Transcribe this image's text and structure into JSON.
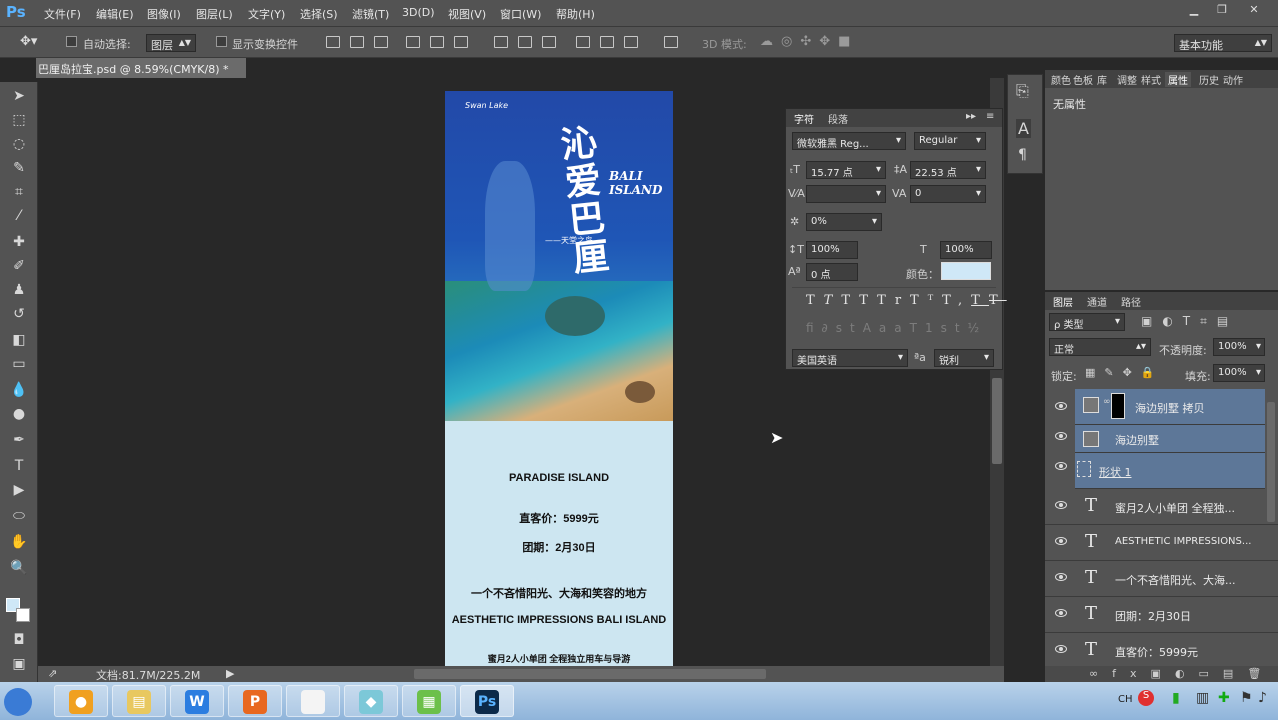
{
  "menubar": {
    "logo": "Ps",
    "items": [
      "文件(F)",
      "编辑(E)",
      "图像(I)",
      "图层(L)",
      "文字(Y)",
      "选择(S)",
      "滤镜(T)",
      "3D(D)",
      "视图(V)",
      "窗口(W)",
      "帮助(H)"
    ]
  },
  "options": {
    "auto_select_label": "自动选择:",
    "auto_select_value": "图层",
    "show_transform_label": "显示变换控件",
    "mode_3d_label": "3D 模式:",
    "workspace": "基本功能"
  },
  "document": {
    "tab_title": "巴厘岛拉宝.psd @ 8.59%(CMYK/8) *",
    "tab_close": "×",
    "status": "文档:81.7M/225.2M",
    "poster": {
      "brand": "Swan Lake",
      "title_cn": "沁爱巴厘",
      "title_en_1": "BALI",
      "title_en_2": "ISLAND",
      "subtitle": "——天堂之岛",
      "line1": "PARADISE ISLAND",
      "line2": "直客价：5999元",
      "line3": "团期：2月30日",
      "line4": "一个不吝惜阳光、大海和笑容的地方",
      "line5": "AESTHETIC IMPRESSIONS BALI ISLAND",
      "line6": "蜜月2人小单团  全程独立用车与导游"
    }
  },
  "char_panel": {
    "tab_char": "字符",
    "tab_para": "段落",
    "font_family": "微软雅黑 Reg...",
    "font_style": "Regular",
    "font_size": "15.77 点",
    "leading": "22.53 点",
    "kerning": "",
    "tracking": "0",
    "scale_pct": "0%",
    "vscale": "100%",
    "hscale": "100%",
    "baseline": "0 点",
    "color_label": "颜色：",
    "text_color": "#cfe8f7",
    "language": "美国英语",
    "aa_label": "ªa",
    "antialias": "锐利"
  },
  "props_panel": {
    "tabs": [
      "颜色",
      "色板",
      "库",
      "调整",
      "样式",
      "属性",
      "历史",
      "动作"
    ],
    "active_tab": "属性",
    "content": "无属性"
  },
  "layers_panel": {
    "tabs": [
      "图层",
      "通道",
      "路径"
    ],
    "filter": "ρ 类型",
    "blend_mode": "正常",
    "opacity_label": "不透明度:",
    "opacity": "100%",
    "lock_label": "锁定:",
    "fill_label": "填充:",
    "fill": "100%",
    "layers": [
      {
        "name": "海边别墅 拷贝",
        "kind": "smart-mask",
        "selected": true
      },
      {
        "name": "海边别墅",
        "kind": "smart",
        "selected": true
      },
      {
        "name": "形状 1",
        "kind": "shape",
        "selected": true
      },
      {
        "name": "蜜月2人小单团  全程独...",
        "kind": "text",
        "selected": false
      },
      {
        "name": "AESTHETIC IMPRESSIONS...",
        "kind": "text",
        "selected": false
      },
      {
        "name": "一个不吝惜阳光、大海...",
        "kind": "text",
        "selected": false
      },
      {
        "name": "团期：2月30日",
        "kind": "text",
        "selected": false
      },
      {
        "name": "直客价：5999元",
        "kind": "text",
        "selected": false
      }
    ]
  },
  "taskbar": {
    "apps": [
      "W",
      "P",
      "Ps"
    ],
    "tray_text": "CH"
  }
}
